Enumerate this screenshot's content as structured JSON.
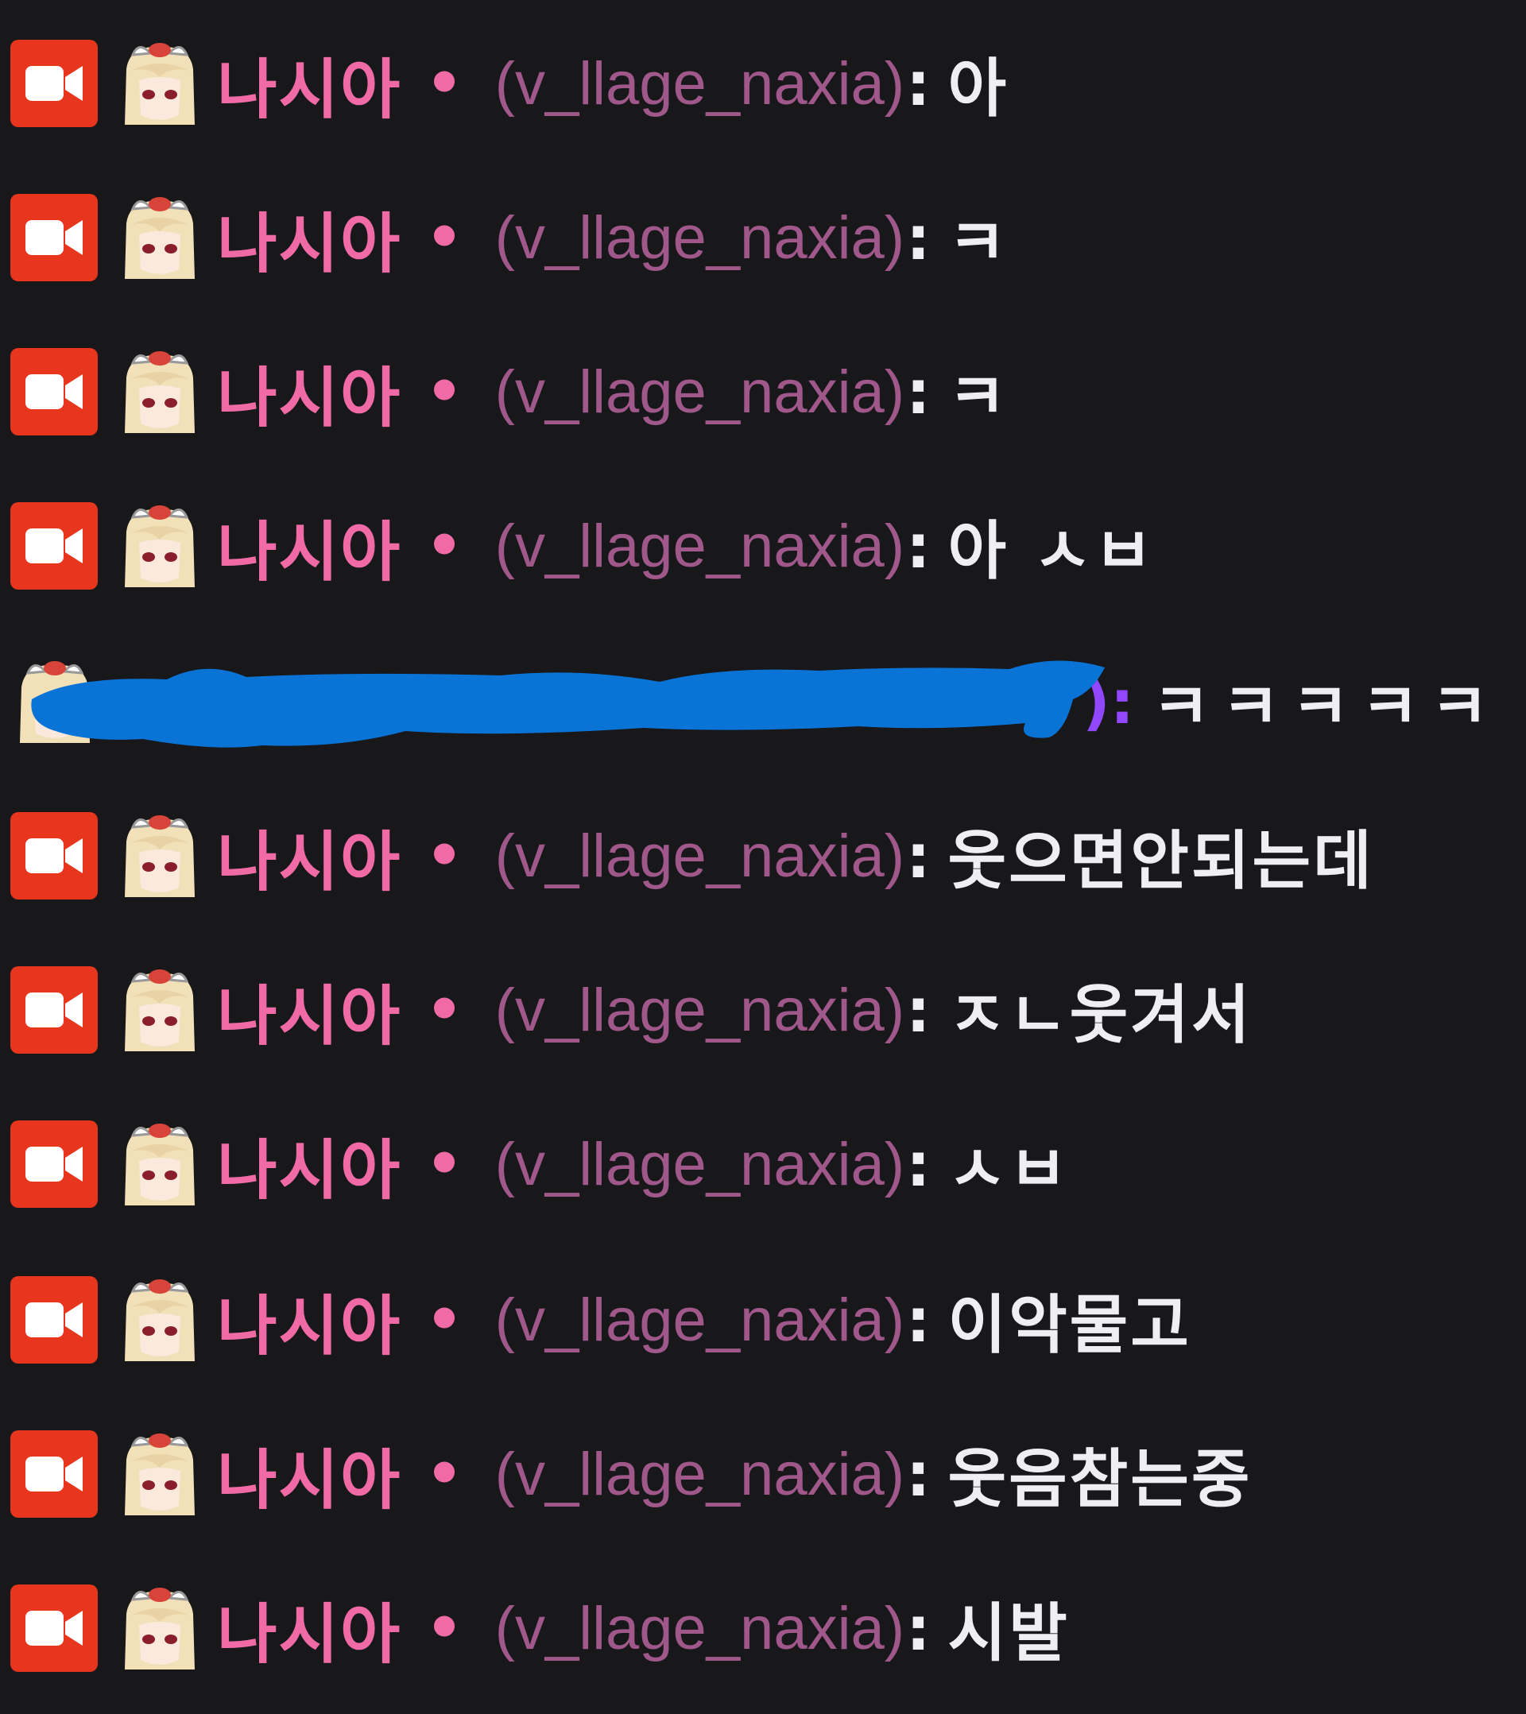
{
  "messages": [
    {
      "badge": "camera-icon",
      "display_name": "나시아",
      "separator": "•",
      "login": "(v_llage_naxia)",
      "colon": ":",
      "text": "아"
    },
    {
      "badge": "camera-icon",
      "display_name": "나시아",
      "separator": "•",
      "login": "(v_llage_naxia)",
      "colon": ":",
      "text": "ㅋ"
    },
    {
      "badge": "camera-icon",
      "display_name": "나시아",
      "separator": "•",
      "login": "(v_llage_naxia)",
      "colon": ":",
      "text": "ㅋ"
    },
    {
      "badge": "camera-icon",
      "display_name": "나시아",
      "separator": "•",
      "login": "(v_llage_naxia)",
      "colon": ":",
      "text": "아 ㅅㅂ"
    },
    {
      "badge": null,
      "display_name": "",
      "separator": "",
      "login": "",
      "colon": "):",
      "text": "ㅋㅋㅋㅋㅋ",
      "redacted": true
    },
    {
      "badge": "camera-icon",
      "display_name": "나시아",
      "separator": "•",
      "login": "(v_llage_naxia)",
      "colon": ":",
      "text": "웃으면안되는데"
    },
    {
      "badge": "camera-icon",
      "display_name": "나시아",
      "separator": "•",
      "login": "(v_llage_naxia)",
      "colon": ":",
      "text": "ㅈㄴ웃겨서"
    },
    {
      "badge": "camera-icon",
      "display_name": "나시아",
      "separator": "•",
      "login": "(v_llage_naxia)",
      "colon": ":",
      "text": "ㅅㅂ"
    },
    {
      "badge": "camera-icon",
      "display_name": "나시아",
      "separator": "•",
      "login": "(v_llage_naxia)",
      "colon": ":",
      "text": "이악물고"
    },
    {
      "badge": "camera-icon",
      "display_name": "나시아",
      "separator": "•",
      "login": "(v_llage_naxia)",
      "colon": ":",
      "text": "웃음참는중"
    },
    {
      "badge": "camera-icon",
      "display_name": "나시아",
      "separator": "•",
      "login": "(v_llage_naxia)",
      "colon": ":",
      "text": "시발"
    }
  ],
  "colors": {
    "background": "#18181b",
    "badge": "#e8361e",
    "display_name": "#f06aa6",
    "login": "#a0588a",
    "message": "#efeff1",
    "scribble": "#0a74d6"
  }
}
